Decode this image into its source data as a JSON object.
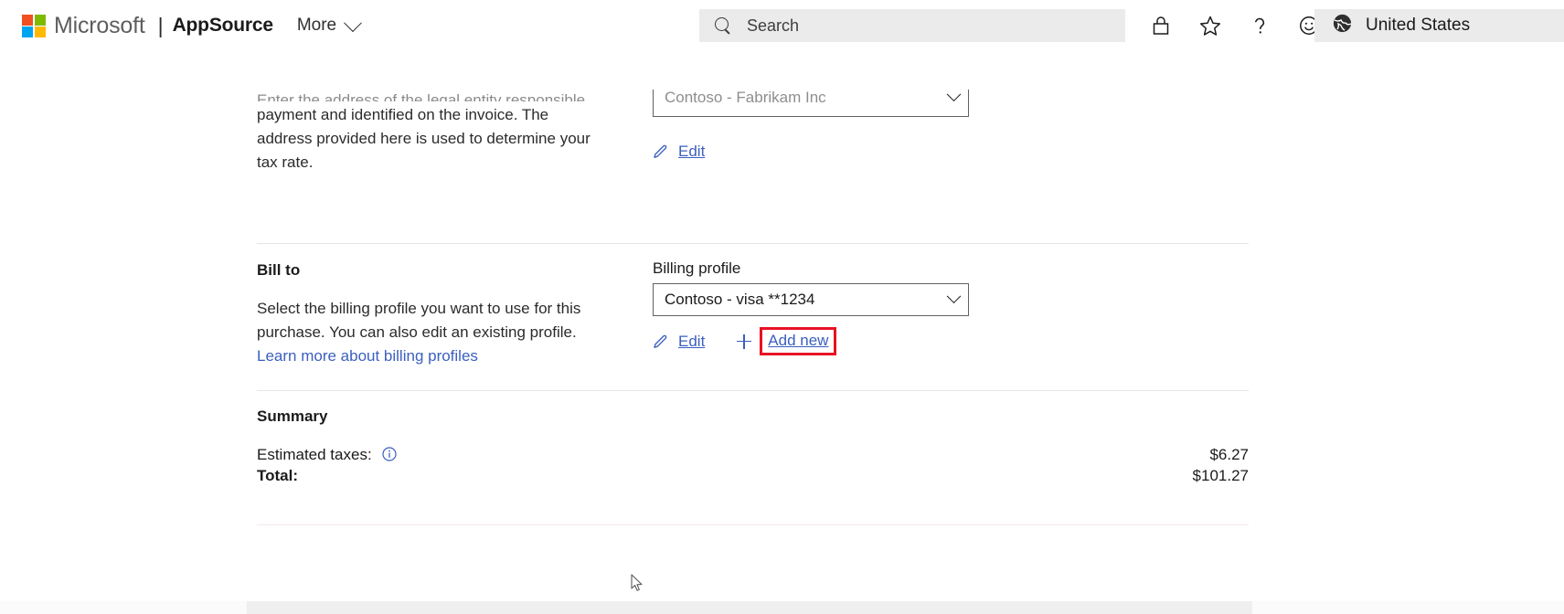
{
  "header": {
    "brand": "Microsoft",
    "divider": "|",
    "product": "AppSource",
    "more_label": "More",
    "more_chevron_icon": "chevron-down-icon",
    "logo_icon": "microsoft-logo-icon",
    "search": {
      "icon": "search-icon",
      "placeholder": "Search",
      "value": ""
    },
    "icons": [
      {
        "name": "lock-icon",
        "title": "Privacy"
      },
      {
        "name": "star-icon",
        "title": "Favorites"
      },
      {
        "name": "question-mark-icon",
        "title": "Help"
      },
      {
        "name": "smiley-face-icon",
        "title": "Feedback"
      }
    ],
    "locale": {
      "icon": "globe-icon",
      "label": "United States"
    }
  },
  "sell_to": {
    "description_line_cut": "Enter the address of the legal entity responsible for",
    "description": "payment and identified on the invoice. The address provided here is used to determine your tax rate.",
    "dropdown_value": "Contoso - Fabrikam Inc",
    "edit": {
      "icon": "pencil-icon",
      "label": "Edit"
    }
  },
  "bill_to": {
    "title": "Bill to",
    "description_part1": "Select the billing profile you want to use for this purchase. You can also edit an existing profile. ",
    "link_text": "Learn more about billing profiles",
    "field_label": "Billing profile",
    "dropdown_value": "Contoso - visa **1234",
    "dropdown_chevron_icon": "chevron-down-icon",
    "edit": {
      "icon": "pencil-icon",
      "label": "Edit"
    },
    "add_new": {
      "icon": "plus-icon",
      "label": "Add new",
      "highlighted": true,
      "highlight_color": "#e81123"
    }
  },
  "summary": {
    "title": "Summary",
    "rows": [
      {
        "label": "Estimated taxes:",
        "amount": "$6.27",
        "info_icon": "info-icon",
        "bold": false
      },
      {
        "label": "Total:",
        "amount": "$101.27",
        "info_icon": null,
        "bold": true
      }
    ]
  },
  "cursor": {
    "icon": "mouse-pointer-icon"
  },
  "colors": {
    "link": "#3b5fbf",
    "highlight": "#e81123",
    "text": "#1b1b1b",
    "header_chip_bg": "#ebebeb"
  }
}
